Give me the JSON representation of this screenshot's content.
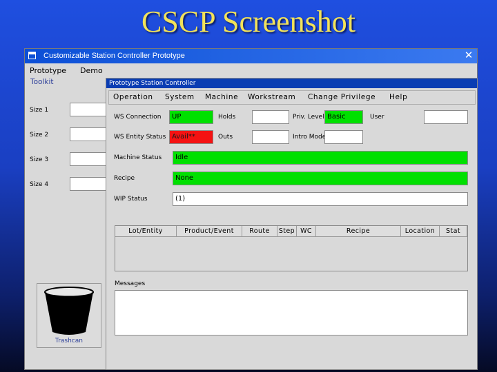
{
  "slide": {
    "title": "CSCP Screenshot"
  },
  "window": {
    "title": "Customizable Station Controller Prototype",
    "close": "✕"
  },
  "menubar": {
    "items": [
      "Prototype",
      "Demo"
    ]
  },
  "toolkit": {
    "label": "Toolkit",
    "sizes": [
      {
        "label": "Size 1",
        "value": ""
      },
      {
        "label": "Size 2",
        "value": ""
      },
      {
        "label": "Size 3",
        "value": ""
      },
      {
        "label": "Size 4",
        "value": ""
      }
    ],
    "trash_label": "Trashcan"
  },
  "controller": {
    "title": "Prototype Station Controller",
    "menu": [
      "Operation",
      "System",
      "Machine",
      "Workstream",
      "Change Privilege",
      "Help"
    ],
    "fields": {
      "ws_connection": {
        "label": "WS Connection",
        "value": "UP",
        "color": "#00e000"
      },
      "holds": {
        "label": "Holds",
        "value": ""
      },
      "priv_level": {
        "label": "Priv. Level",
        "value": "Basic",
        "color": "#00e000"
      },
      "user": {
        "label": "User",
        "value": ""
      },
      "ws_entity_status": {
        "label": "WS Entity Status",
        "value": "Avail**",
        "color": "#f51212"
      },
      "outs": {
        "label": "Outs",
        "value": ""
      },
      "intro_mode": {
        "label": "Intro Mode",
        "value": ""
      },
      "machine_status": {
        "label": "Machine Status",
        "value": "Idle",
        "color": "#00e000"
      },
      "recipe": {
        "label": "Recipe",
        "value": "None",
        "color": "#00e000"
      },
      "wip_status": {
        "label": "WIP Status",
        "value": "(1)"
      }
    },
    "table": {
      "columns": [
        "Lot/Entity",
        "Product/Event",
        "Route",
        "Step",
        "WC",
        "Recipe",
        "Location",
        "Stat"
      ],
      "rows": []
    },
    "messages": {
      "label": "Messages",
      "value": ""
    }
  }
}
